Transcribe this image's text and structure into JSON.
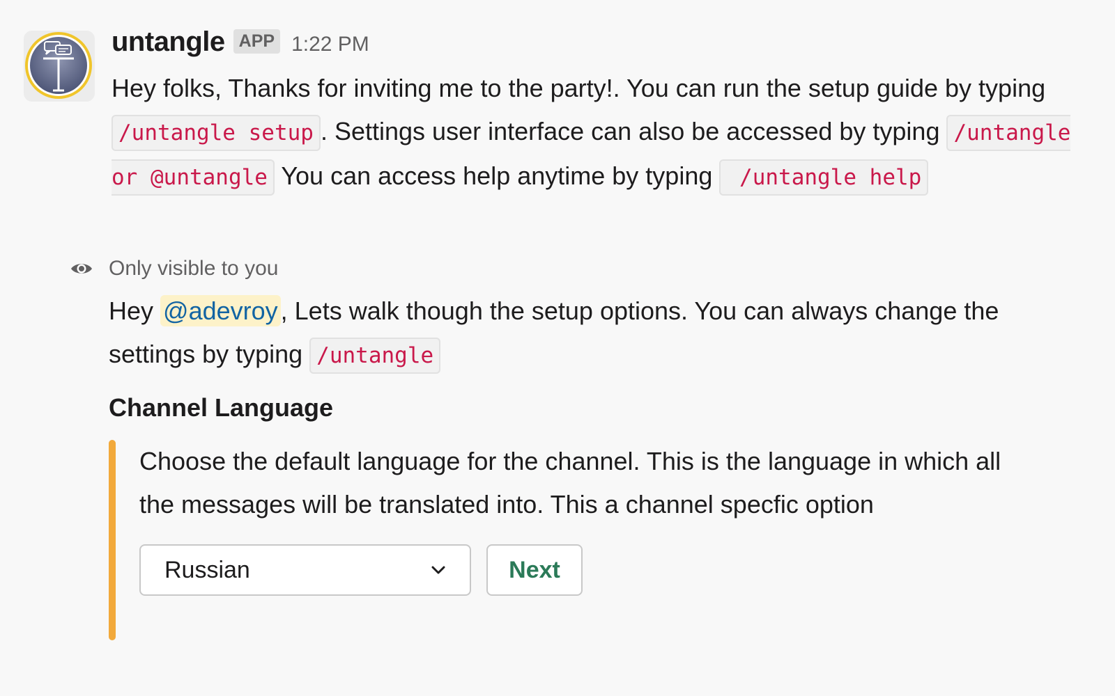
{
  "message": {
    "sender": "untangle",
    "badge": "APP",
    "time": "1:22 PM",
    "text_1": "Hey folks, Thanks for inviting me to the party!. You can run the setup guide by typing ",
    "code_1": "/untangle setup",
    "text_2": ". Settings user interface can also be accessed by typing ",
    "code_2": "/untangle or @untangle",
    "text_3": " You can access help anytime by typing ",
    "code_3": " /untangle help"
  },
  "visibility": {
    "icon": "eye-icon",
    "label": "Only visible to you"
  },
  "ephemeral": {
    "greeting": "Hey ",
    "mention": "@adevroy",
    "text_1": ", Lets walk though the setup options. You can always change the settings by typing ",
    "code": "/untangle",
    "section_title": "Channel Language",
    "description": "Choose the default language for the channel. This is the language in which all the messages will be translated into. This a channel specfic option",
    "select_value": "Russian",
    "next_label": "Next"
  },
  "colors": {
    "accent_bar": "#f2a93b",
    "code_text": "#c9184a",
    "mention_text": "#1264a3",
    "button_text": "#2b7a58"
  }
}
